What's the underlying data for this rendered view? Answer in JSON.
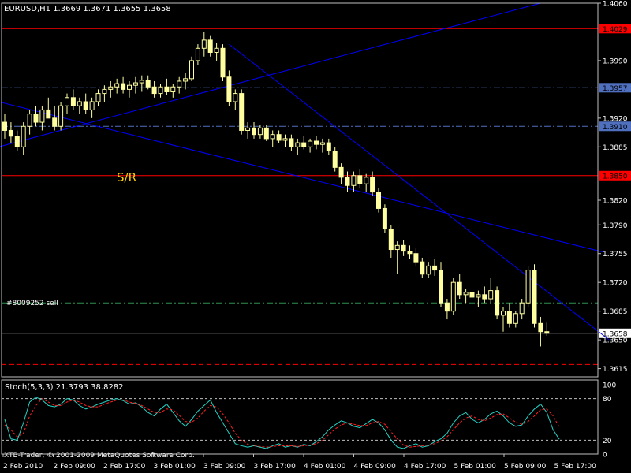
{
  "colors": {
    "background": "#000000",
    "frame": "#c0c0c0",
    "candle": "#ffffa0",
    "trendline": "#0000ff",
    "resistance": "#ff0000",
    "support_line": "#4f6fbf",
    "order_line": "#2f8f4f",
    "ask_line": "#aaaaaa",
    "stoch_main": "#22d3c5",
    "stoch_signal": "#ff2020",
    "text": "#ffffff",
    "sr_label": "#ffd000"
  },
  "chart_data": [
    {
      "type": "candlestick",
      "title": "EURUSD,H1  1.3669 1.3671 1.3655 1.3658",
      "annotation_sr": "S/R",
      "annotation_order": "#8009252 sell",
      "ylim": [
        1.3605,
        1.406
      ],
      "y_ticks": [
        1.406,
        1.399,
        1.392,
        1.3885,
        1.382,
        1.379,
        1.3755,
        1.372,
        1.3685,
        1.365,
        1.3615
      ],
      "x_tick_labels": [
        "2 Feb 2010",
        "2 Feb 09:00",
        "2 Feb 17:00",
        "3 Feb 01:00",
        "3 Feb 09:00",
        "3 Feb 17:00",
        "4 Feb 01:00",
        "4 Feb 09:00",
        "4 Feb 17:00",
        "5 Feb 01:00",
        "5 Feb 09:00",
        "5 Feb 17:00"
      ],
      "grid": false,
      "price_levels": [
        {
          "label": "1.4029",
          "value": 1.4029,
          "style": "resistance"
        },
        {
          "label": "1.3957",
          "value": 1.3957,
          "style": "support_line"
        },
        {
          "label": "1.3910",
          "value": 1.391,
          "style": "support_line"
        },
        {
          "label": "1.3850",
          "value": 1.385,
          "style": "resistance"
        },
        {
          "label": "",
          "value": 1.3695,
          "style": "order_line"
        },
        {
          "label": "1.3658",
          "value": 1.3658,
          "style": "ask_line"
        },
        {
          "label": "",
          "value": 1.362,
          "style": "resistance"
        }
      ],
      "ohlc": [
        [
          1.3915,
          1.3925,
          1.3895,
          1.3905
        ],
        [
          1.3905,
          1.3915,
          1.389,
          1.3898
        ],
        [
          1.3898,
          1.3905,
          1.388,
          1.3885
        ],
        [
          1.3885,
          1.3915,
          1.3875,
          1.391
        ],
        [
          1.391,
          1.393,
          1.39,
          1.3925
        ],
        [
          1.3925,
          1.3935,
          1.391,
          1.3915
        ],
        [
          1.3915,
          1.3935,
          1.3905,
          1.393
        ],
        [
          1.393,
          1.3945,
          1.392,
          1.392
        ],
        [
          1.392,
          1.3935,
          1.3905,
          1.391
        ],
        [
          1.391,
          1.394,
          1.3905,
          1.3935
        ],
        [
          1.3935,
          1.395,
          1.3925,
          1.3945
        ],
        [
          1.3945,
          1.3955,
          1.393,
          1.3935
        ],
        [
          1.3935,
          1.3945,
          1.3925,
          1.394
        ],
        [
          1.394,
          1.395,
          1.3925,
          1.393
        ],
        [
          1.393,
          1.3945,
          1.392,
          1.394
        ],
        [
          1.394,
          1.3955,
          1.3935,
          1.395
        ],
        [
          1.395,
          1.396,
          1.394,
          1.3955
        ],
        [
          1.3955,
          1.3965,
          1.3945,
          1.3958
        ],
        [
          1.3958,
          1.3968,
          1.395,
          1.3962
        ],
        [
          1.3962,
          1.397,
          1.395,
          1.3955
        ],
        [
          1.3955,
          1.3965,
          1.3945,
          1.396
        ],
        [
          1.396,
          1.397,
          1.395,
          1.3963
        ],
        [
          1.3963,
          1.3972,
          1.3952,
          1.3966
        ],
        [
          1.3966,
          1.3972,
          1.3955,
          1.3958
        ],
        [
          1.3958,
          1.3965,
          1.3945,
          1.395
        ],
        [
          1.395,
          1.3962,
          1.3945,
          1.3958
        ],
        [
          1.3958,
          1.3968,
          1.3948,
          1.3952
        ],
        [
          1.3952,
          1.3962,
          1.3945,
          1.3958
        ],
        [
          1.3958,
          1.397,
          1.395,
          1.3965
        ],
        [
          1.3965,
          1.3975,
          1.3955,
          1.3968
        ],
        [
          1.3968,
          1.3995,
          1.3965,
          1.399
        ],
        [
          1.399,
          1.401,
          1.3985,
          1.4005
        ],
        [
          1.4005,
          1.4025,
          1.3995,
          1.4015
        ],
        [
          1.4015,
          1.402,
          1.3995,
          1.4
        ],
        [
          1.4,
          1.4012,
          1.399,
          1.4005
        ],
        [
          1.4005,
          1.401,
          1.3965,
          1.397
        ],
        [
          1.397,
          1.3978,
          1.3935,
          1.394
        ],
        [
          1.394,
          1.3955,
          1.393,
          1.395
        ],
        [
          1.395,
          1.3955,
          1.39,
          1.3905
        ],
        [
          1.3905,
          1.3915,
          1.3895,
          1.3908
        ],
        [
          1.3908,
          1.3915,
          1.3895,
          1.39
        ],
        [
          1.39,
          1.3912,
          1.3895,
          1.3908
        ],
        [
          1.3908,
          1.3912,
          1.3892,
          1.3895
        ],
        [
          1.3895,
          1.3905,
          1.3885,
          1.39
        ],
        [
          1.39,
          1.3905,
          1.389,
          1.3893
        ],
        [
          1.3893,
          1.39,
          1.3885,
          1.3895
        ],
        [
          1.3895,
          1.39,
          1.388,
          1.3885
        ],
        [
          1.3885,
          1.3895,
          1.3875,
          1.389
        ],
        [
          1.389,
          1.3898,
          1.3882,
          1.3885
        ],
        [
          1.3885,
          1.3895,
          1.3878,
          1.3892
        ],
        [
          1.3892,
          1.3898,
          1.3882,
          1.3888
        ],
        [
          1.3888,
          1.3895,
          1.3878,
          1.389
        ],
        [
          1.389,
          1.3895,
          1.3875,
          1.388
        ],
        [
          1.388,
          1.3885,
          1.3855,
          1.386
        ],
        [
          1.386,
          1.3865,
          1.384,
          1.3848
        ],
        [
          1.3848,
          1.3855,
          1.383,
          1.3838
        ],
        [
          1.3838,
          1.3855,
          1.383,
          1.385
        ],
        [
          1.385,
          1.3858,
          1.3835,
          1.384
        ],
        [
          1.384,
          1.3852,
          1.383,
          1.3848
        ],
        [
          1.3848,
          1.3855,
          1.3825,
          1.383
        ],
        [
          1.383,
          1.3835,
          1.3805,
          1.381
        ],
        [
          1.381,
          1.3815,
          1.378,
          1.3785
        ],
        [
          1.3785,
          1.379,
          1.375,
          1.376
        ],
        [
          1.376,
          1.377,
          1.373,
          1.3765
        ],
        [
          1.3765,
          1.3772,
          1.3752,
          1.3758
        ],
        [
          1.3758,
          1.3765,
          1.3748,
          1.3755
        ],
        [
          1.3755,
          1.3762,
          1.374,
          1.3745
        ],
        [
          1.3745,
          1.375,
          1.3725,
          1.373
        ],
        [
          1.373,
          1.3745,
          1.3725,
          1.374
        ],
        [
          1.374,
          1.3748,
          1.3728,
          1.3735
        ],
        [
          1.3735,
          1.3745,
          1.369,
          1.3695
        ],
        [
          1.3695,
          1.37,
          1.3675,
          1.3685
        ],
        [
          1.3685,
          1.3725,
          1.368,
          1.372
        ],
        [
          1.372,
          1.373,
          1.37,
          1.3705
        ],
        [
          1.3705,
          1.3712,
          1.3695,
          1.3708
        ],
        [
          1.3708,
          1.3712,
          1.3698,
          1.3702
        ],
        [
          1.3702,
          1.371,
          1.369,
          1.3705
        ],
        [
          1.3705,
          1.3715,
          1.3695,
          1.37
        ],
        [
          1.37,
          1.3725,
          1.3695,
          1.371
        ],
        [
          1.371,
          1.3715,
          1.3675,
          1.368
        ],
        [
          1.368,
          1.369,
          1.366,
          1.3685
        ],
        [
          1.3685,
          1.3695,
          1.3665,
          1.367
        ],
        [
          1.367,
          1.3685,
          1.3665,
          1.3682
        ],
        [
          1.3682,
          1.37,
          1.3675,
          1.3695
        ],
        [
          1.3695,
          1.374,
          1.369,
          1.3735
        ],
        [
          1.3735,
          1.3742,
          1.3665,
          1.367
        ],
        [
          1.367,
          1.3678,
          1.3642,
          1.366
        ],
        [
          1.366,
          1.3671,
          1.3655,
          1.3658
        ]
      ]
    },
    {
      "type": "line",
      "title": "Stoch(5,3,3) 21.3793 38.8282",
      "ylim": [
        0,
        100
      ],
      "y_ticks": [
        100,
        80,
        20,
        0
      ],
      "levels": [
        80,
        20
      ],
      "series": [
        {
          "values": [
            50,
            22,
            20,
            45,
            75,
            82,
            78,
            70,
            68,
            72,
            80,
            78,
            70,
            65,
            68,
            72,
            75,
            78,
            80,
            77,
            72,
            74,
            68,
            60,
            55,
            65,
            72,
            60,
            48,
            40,
            50,
            62,
            70,
            78,
            60,
            45,
            30,
            15,
            12,
            10,
            12,
            10,
            8,
            12,
            15,
            10,
            12,
            10,
            14,
            12,
            18,
            25,
            35,
            42,
            48,
            45,
            40,
            38,
            44,
            50,
            45,
            35,
            20,
            10,
            8,
            12,
            15,
            10,
            12,
            18,
            22,
            30,
            45,
            55,
            60,
            50,
            45,
            50,
            58,
            62,
            55,
            45,
            40,
            42,
            55,
            65,
            72,
            60,
            35,
            21.4
          ]
        },
        {
          "values": [
            42,
            35,
            25,
            30,
            55,
            70,
            80,
            75,
            70,
            70,
            75,
            78,
            75,
            70,
            68,
            68,
            72,
            75,
            78,
            78,
            75,
            73,
            70,
            65,
            60,
            60,
            65,
            64,
            56,
            47,
            46,
            52,
            62,
            70,
            68,
            58,
            45,
            30,
            20,
            14,
            12,
            11,
            10,
            11,
            12,
            12,
            12,
            11,
            12,
            13,
            15,
            20,
            28,
            36,
            42,
            45,
            43,
            41,
            41,
            45,
            47,
            43,
            32,
            22,
            13,
            10,
            11,
            12,
            13,
            15,
            19,
            25,
            35,
            45,
            52,
            55,
            50,
            48,
            52,
            57,
            58,
            52,
            46,
            43,
            47,
            55,
            64,
            65,
            55,
            38.8
          ]
        }
      ]
    }
  ],
  "footer": {
    "copyright": "XTB-Trader, © 2001-2009 MetaQuotes Software Corp."
  }
}
